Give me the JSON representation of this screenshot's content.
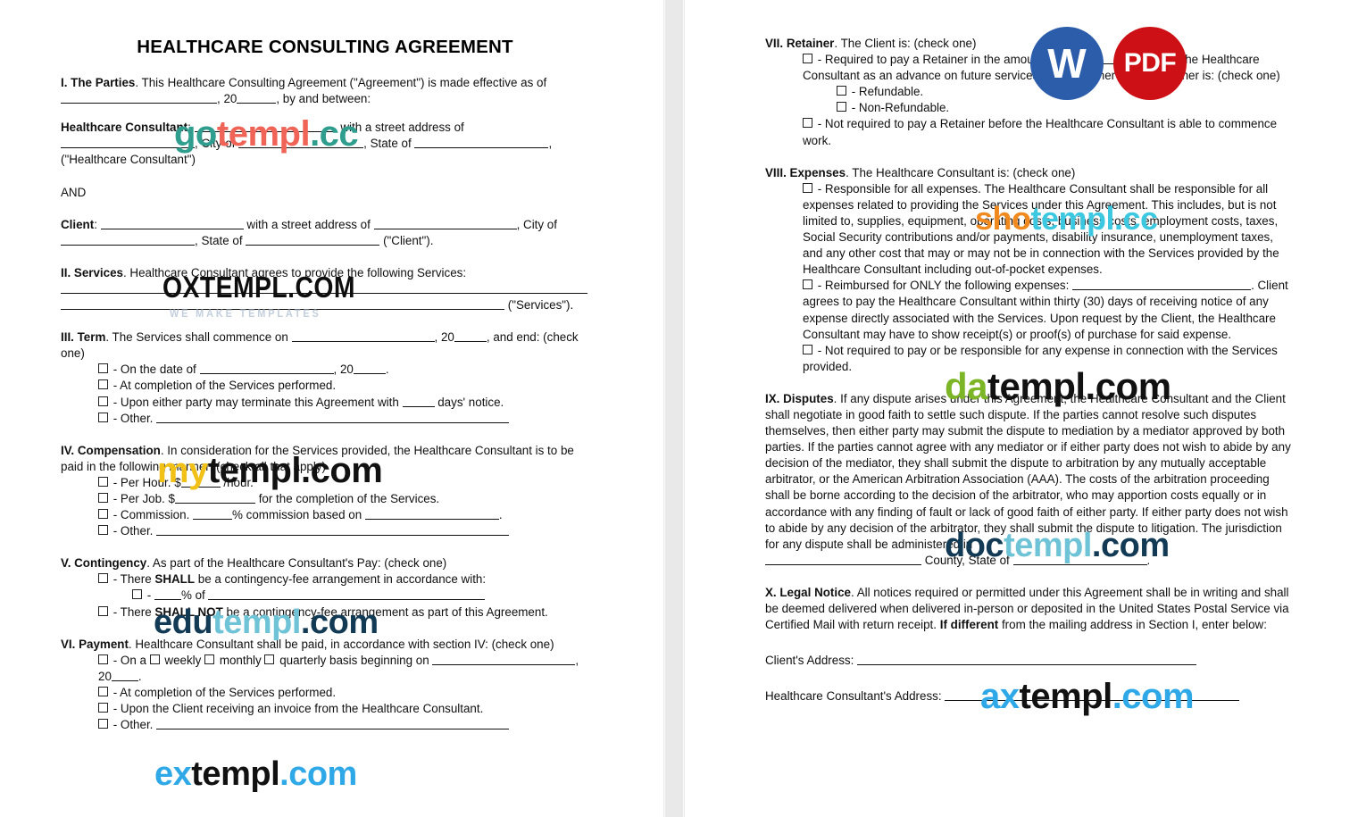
{
  "document": {
    "title": "HEALTHCARE CONSULTING AGREEMENT"
  },
  "left_column": {
    "s1": {
      "heading": "I. The Parties",
      "t1": ". This Healthcare Consulting Agreement (\"Agreement\") is made effective as of",
      "t2": ", 20",
      "t3": ", by and between:",
      "consultant_label": "Healthcare Consultant",
      "consultant_t1": ":",
      "consultant_t2": "with a street address of",
      "consultant_t3": ", City of",
      "consultant_t4": ", State of",
      "consultant_t5": ", (\"Healthcare Consultant\")",
      "and": "AND",
      "client_label": "Client",
      "client_t1": ":",
      "client_t2": "with a street address of",
      "client_t3": ", City of",
      "client_t4": ", State of",
      "client_t5": "(\"Client\")."
    },
    "s2": {
      "heading": "II. Services",
      "t1": ". Healthcare Consultant agrees to provide the following Services:",
      "t2": "(\"Services\")."
    },
    "s3": {
      "heading": "III. Term",
      "t1": ". The Services shall commence on",
      "t2": ", 20",
      "t3": ", and end: (check one)",
      "o1a": "- On the date of",
      "o1b": ", 20",
      "o1c": ".",
      "o2": "- At completion of the Services performed.",
      "o3a": "- Upon either party may terminate this Agreement with",
      "o3b": "days' notice.",
      "o4": "- Other."
    },
    "s4": {
      "heading": "IV. Compensation",
      "t1": ". In consideration for the Services provided, the Healthcare Consultant is to be paid in the following manner: (check all that apply)",
      "o1a": "- Per Hour. $",
      "o1b": "/hour.",
      "o2a": "- Per Job. $",
      "o2b": "for the completion of the Services.",
      "o3a": "- Commission.",
      "o3b": "% commission based on",
      "o3c": ".",
      "o4": "- Other."
    },
    "s5": {
      "heading": "V. Contingency",
      "t1": ". As part of the Healthcare Consultant's Pay: (check one)",
      "o1a": "- There",
      "o1b": "SHALL",
      "o1c": "be a contingency-fee arrangement in accordance with:",
      "sub1a": "-",
      "sub1b": "% of",
      "o2a": "- There",
      "o2b": "SHALL NOT",
      "o2c": "be a contingency-fee arrangement as part of this Agreement."
    },
    "s6": {
      "heading": "VI. Payment",
      "t1": ". Healthcare Consultant shall be paid, in accordance with section IV: (check one)",
      "o1a": "- On a",
      "o1b": "weekly",
      "o1c": "monthly",
      "o1d": "quarterly basis beginning on",
      "o1e": ", 20",
      "o1f": ".",
      "o2": "- At completion of the Services performed.",
      "o3": "- Upon the Client receiving an invoice from the Healthcare Consultant.",
      "o4": "- Other."
    }
  },
  "right_column": {
    "s7": {
      "heading": "VII. Retainer",
      "t1": ". The Client is: (check one)",
      "o1a": "- Required to pay a Retainer in the amount of $",
      "o1b": "to the Healthcare Consultant as an advance on future services (the \"Retainer\"). The Retainer is: (check one)",
      "sub1": "- Refundable.",
      "sub2": "- Non-Refundable.",
      "o2": "- Not required to pay a Retainer before the Healthcare Consultant is able to commence work."
    },
    "s8": {
      "heading": "VIII. Expenses",
      "t1": ". The Healthcare Consultant is: (check one)",
      "o1": "- Responsible for all expenses. The Healthcare Consultant shall be responsible for all expenses related to providing the Services under this Agreement. This includes, but is not limited to, supplies, equipment, operating costs, business costs, employment costs, taxes, Social Security contributions and/or payments, disability insurance, unemployment taxes, and any other cost that may or may not be in connection with the Services provided by the Healthcare Consultant including out-of-pocket expenses.",
      "o2a": "- Reimbursed for ONLY the following expenses:",
      "o2b": ". Client agrees to pay the Healthcare Consultant within thirty (30) days of receiving notice of any expense directly associated with the Services. Upon request by the Client, the Healthcare Consultant may have to show receipt(s) or proof(s) of purchase for said expense.",
      "o3": "- Not required to pay or be responsible for any expense in connection with the Services provided."
    },
    "s9": {
      "heading": "IX. Disputes",
      "t1": ". If any dispute arises under this Agreement, the Healthcare Consultant and the Client shall negotiate in good faith to settle such dispute. If the parties cannot resolve such disputes themselves, then either party may submit the dispute to mediation by a mediator approved by both parties. If the parties cannot agree with any mediator or if either party does not wish to abide by any decision of the mediator, they shall submit the dispute to arbitration by any mutually acceptable arbitrator, or the American Arbitration Association (AAA). The costs of the arbitration proceeding shall be borne according to the decision of the arbitrator, who may apportion costs equally or in accordance with any finding of fault or lack of good faith of either party. If either party does not wish to abide by any decision of the arbitrator, they shall submit the dispute to litigation. The jurisdiction for any dispute shall be administered in",
      "t2": "County, State of",
      "t3": "."
    },
    "s10": {
      "heading": "X. Legal Notice",
      "t1": ". All notices required or permitted under this Agreement shall be in writing and shall be deemed delivered when delivered in-person or deposited in the United States Postal Service via Certified Mail with return receipt.",
      "t2": "If different",
      "t3": "from the mailing address in Section I, enter below:",
      "client_address_label": "Client's Address:",
      "consultant_address_label": "Healthcare Consultant's Address:"
    }
  },
  "watermarks": {
    "gotempl": {
      "part1": "go",
      "part2": "templ",
      "part3": ".cc",
      "color1": "#2f9e8f",
      "color2": "#ef6457",
      "color3": "#2f9e8f"
    },
    "oxtempl": {
      "text": "OXTEMPL.COM",
      "tagline": "WE MAKE TEMPLATES",
      "color": "#0d0d0d",
      "tagline_color": "#c3cfdd"
    },
    "mytempl": {
      "part1": "my",
      "part2": "templ.com",
      "color1": "#f2c117",
      "color2": "#111111"
    },
    "edutempl": {
      "part1": "edu",
      "part2": "templ",
      "part3": ".com",
      "color1": "#123a55",
      "color2": "#6fc3d6",
      "color3": "#123a55"
    },
    "extempl": {
      "part1": "ex",
      "part2": "templ",
      "part3": ".com",
      "color1": "#2fa8e8",
      "color2": "#111111",
      "color3": "#2fa8e8"
    },
    "shotempl": {
      "part1": "sho",
      "part2": "templ",
      "part3": ".cc",
      "color1": "#f08a1e",
      "color2": "#3cc8e0",
      "color3": "#3cc8e0"
    },
    "datempl": {
      "part1": "da",
      "part2": "templ.com",
      "color1": "#7cb626",
      "color2": "#111111"
    },
    "doctempl": {
      "part1": "doc",
      "part2": "templ",
      "part3": ".com",
      "color1": "#123a55",
      "color2": "#6fc3d6",
      "color3": "#123a55"
    },
    "axtempl": {
      "part1": "ax",
      "part2": "templ",
      "part3": ".com",
      "color1": "#2fa8e8",
      "color2": "#111111",
      "color3": "#2fa8e8"
    }
  },
  "badges": {
    "word": {
      "label": "W",
      "color": "#2b5dab"
    },
    "pdf": {
      "label": "PDF",
      "color": "#cc1016"
    }
  }
}
